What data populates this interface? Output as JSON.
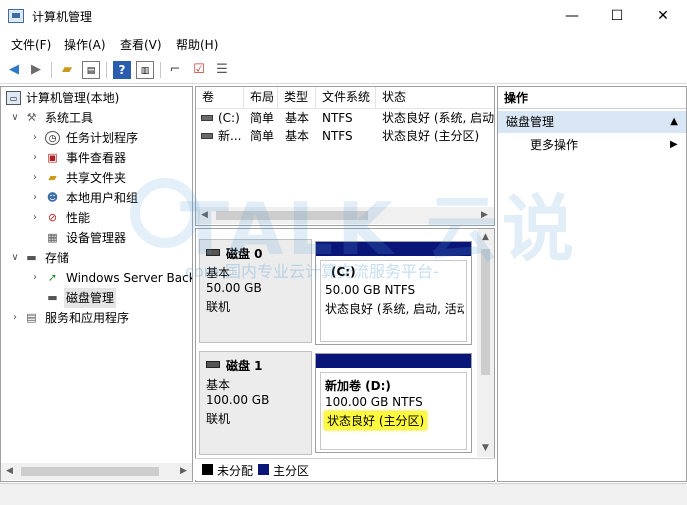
{
  "window": {
    "title": "计算机管理",
    "minimize": "—",
    "maximize": "☐",
    "close": "✕"
  },
  "menu": [
    "文件(F)",
    "操作(A)",
    "查看(V)",
    "帮助(H)"
  ],
  "toolbar_icons": [
    "back-arrow-icon",
    "forward-arrow-icon",
    "folder-up-icon",
    "console-tree-icon",
    "help-icon",
    "properties-icon",
    "connect-icon",
    "check-icon",
    "export-list-icon"
  ],
  "tree": {
    "root": "计算机管理(本地)",
    "system_tools": "系统工具",
    "task_scheduler": "任务计划程序",
    "event_viewer": "事件查看器",
    "shared_folders": "共享文件夹",
    "local_users": "本地用户和组",
    "performance": "性能",
    "device_manager": "设备管理器",
    "storage": "存储",
    "windows_backup": "Windows Server Backup",
    "disk_management": "磁盘管理",
    "services_apps": "服务和应用程序"
  },
  "volumes": {
    "columns": [
      "卷",
      "布局",
      "类型",
      "文件系统",
      "状态"
    ],
    "rows": [
      {
        "volume": "(C:)",
        "layout": "简单",
        "type": "基本",
        "fs": "NTFS",
        "status": "状态良好 (系统, 启动"
      },
      {
        "volume": "新...",
        "layout": "简单",
        "type": "基本",
        "fs": "NTFS",
        "status": "状态良好 (主分区)"
      }
    ]
  },
  "disks": [
    {
      "name": "磁盘 0",
      "type": "基本",
      "size": "50.00 GB",
      "state": "联机",
      "partition": {
        "label": "(C:)",
        "size_fs": "50.00 GB NTFS",
        "status": "状态良好 (系统, 启动, 活动"
      }
    },
    {
      "name": "磁盘 1",
      "type": "基本",
      "size": "100.00 GB",
      "state": "联机",
      "partition": {
        "label": "新加卷  (D:)",
        "size_fs": "100.00 GB NTFS",
        "status": "状态良好 (主分区)"
      }
    }
  ],
  "legend": {
    "unallocated": "未分配",
    "primary": "主分区",
    "unallocated_color": "#000000",
    "primary_color": "#0a157a"
  },
  "actions": {
    "header": "操作",
    "section": "磁盘管理",
    "more": "更多操作"
  },
  "watermark": {
    "brand": "TALK 云说",
    "tagline": ".com-国内专业云计算交流服务平台-"
  }
}
